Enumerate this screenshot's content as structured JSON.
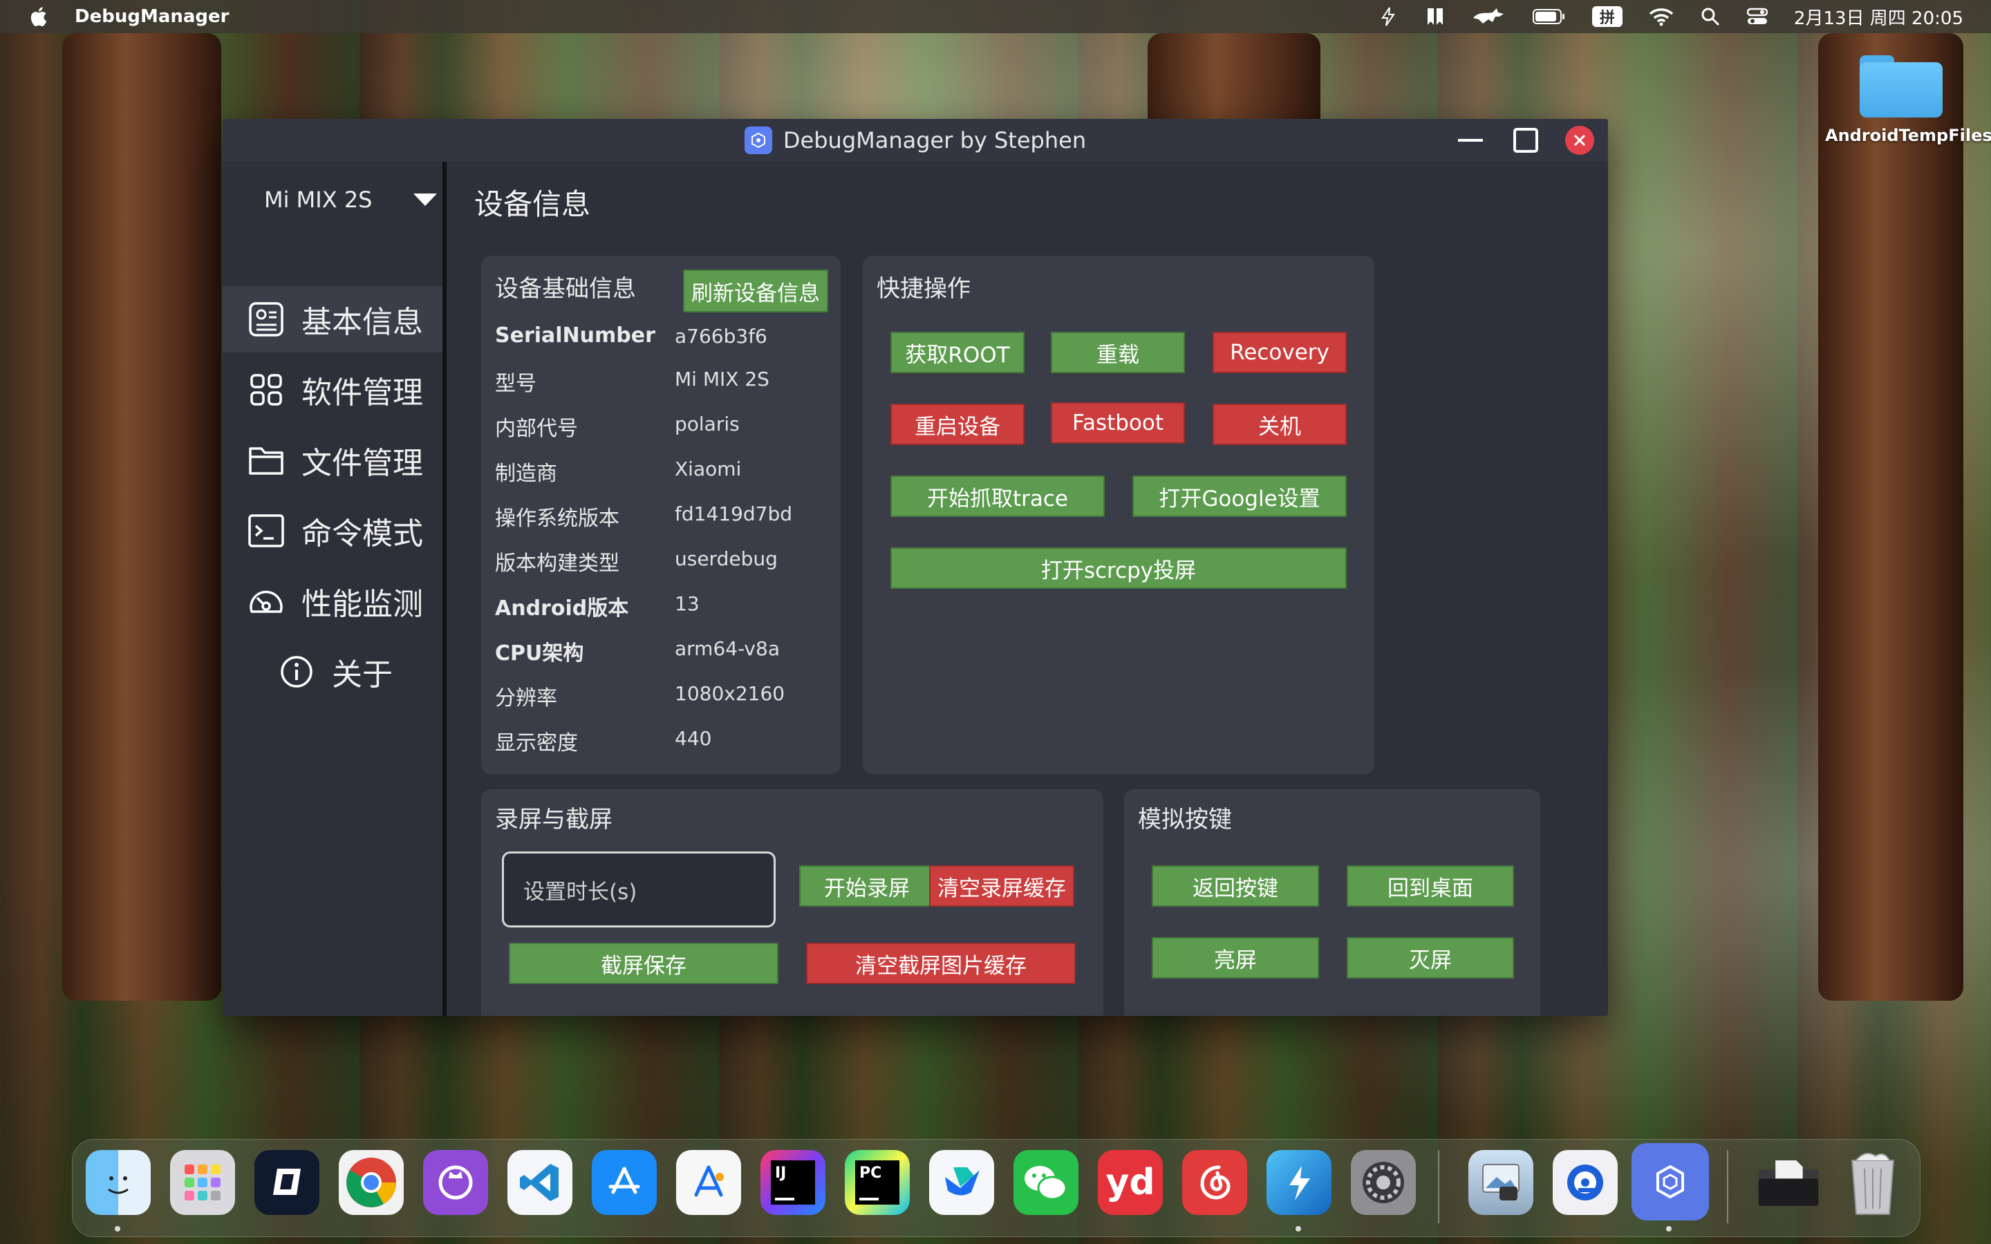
{
  "menubar": {
    "app_name": "DebugManager",
    "input_method": "拼",
    "datetime": "2月13日 周四 20:05"
  },
  "desktop": {
    "folder_label": "AndroidTempFiles"
  },
  "window": {
    "title": "DebugManager by Stephen"
  },
  "sidebar": {
    "device": "Mi MIX 2S",
    "items": [
      {
        "label": "基本信息",
        "icon": "id-card-icon",
        "active": true
      },
      {
        "label": "软件管理",
        "icon": "apps-grid-icon"
      },
      {
        "label": "文件管理",
        "icon": "folder-icon"
      },
      {
        "label": "命令模式",
        "icon": "terminal-icon"
      },
      {
        "label": "性能监测",
        "icon": "gauge-icon"
      },
      {
        "label": "关于",
        "icon": "info-icon"
      }
    ]
  },
  "main": {
    "title": "设备信息",
    "device_info": {
      "title": "设备基础信息",
      "refresh_label": "刷新设备信息",
      "rows": [
        {
          "key": "SerialNumber",
          "value": "a766b3f6"
        },
        {
          "key": "型号",
          "value": "Mi MIX 2S"
        },
        {
          "key": "内部代号",
          "value": "polaris"
        },
        {
          "key": "制造商",
          "value": "Xiaomi"
        },
        {
          "key": "操作系统版本",
          "value": "fd1419d7bd"
        },
        {
          "key": "版本构建类型",
          "value": "userdebug"
        },
        {
          "key": "Android版本",
          "value": "13"
        },
        {
          "key": "CPU架构",
          "value": "arm64-v8a"
        },
        {
          "key": "分辨率",
          "value": "1080x2160"
        },
        {
          "key": "显示密度",
          "value": "440"
        }
      ]
    },
    "quick": {
      "title": "快捷操作",
      "get_root": "获取ROOT",
      "remount": "重载",
      "recovery": "Recovery",
      "reboot": "重启设备",
      "fastboot": "Fastboot",
      "shutdown": "关机",
      "start_trace": "开始抓取trace",
      "open_google": "打开Google设置",
      "open_scrcpy": "打开scrcpy投屏"
    },
    "record": {
      "title": "录屏与截屏",
      "duration_placeholder": "设置时长(s)",
      "start_record": "开始录屏",
      "clear_record_cache": "清空录屏缓存",
      "screenshot_save": "截屏保存",
      "clear_screenshot_cache": "清空截屏图片缓存"
    },
    "keys": {
      "title": "模拟按键",
      "back": "返回按键",
      "home": "回到桌面",
      "screen_on": "亮屏",
      "screen_off": "灭屏"
    }
  },
  "dock": {
    "ydao_label": "yd"
  },
  "colors": {
    "green_button": "#5d9c4f",
    "red_button": "#cc3d3d",
    "window_bg": "#2e3039",
    "card_bg": "#3a3d48",
    "close_button": "#e3404c"
  }
}
